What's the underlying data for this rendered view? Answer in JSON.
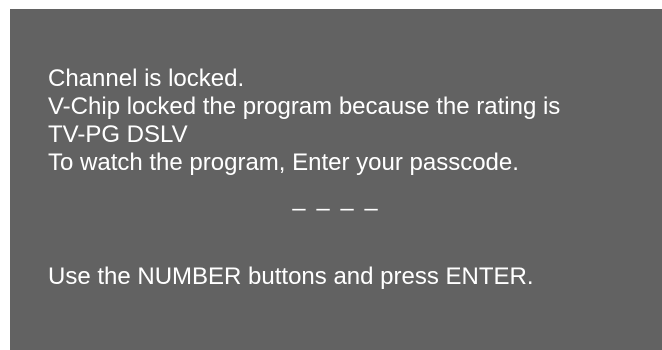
{
  "dialog": {
    "lines": [
      "Channel is locked.",
      "V-Chip locked the program because the rating is",
      "TV-PG DSLV",
      "To watch the program, Enter your passcode."
    ],
    "passcode_placeholder": "– – – –",
    "hint": "Use the NUMBER buttons and press ENTER."
  },
  "colors": {
    "background": "#626262",
    "text": "#ffffff"
  }
}
